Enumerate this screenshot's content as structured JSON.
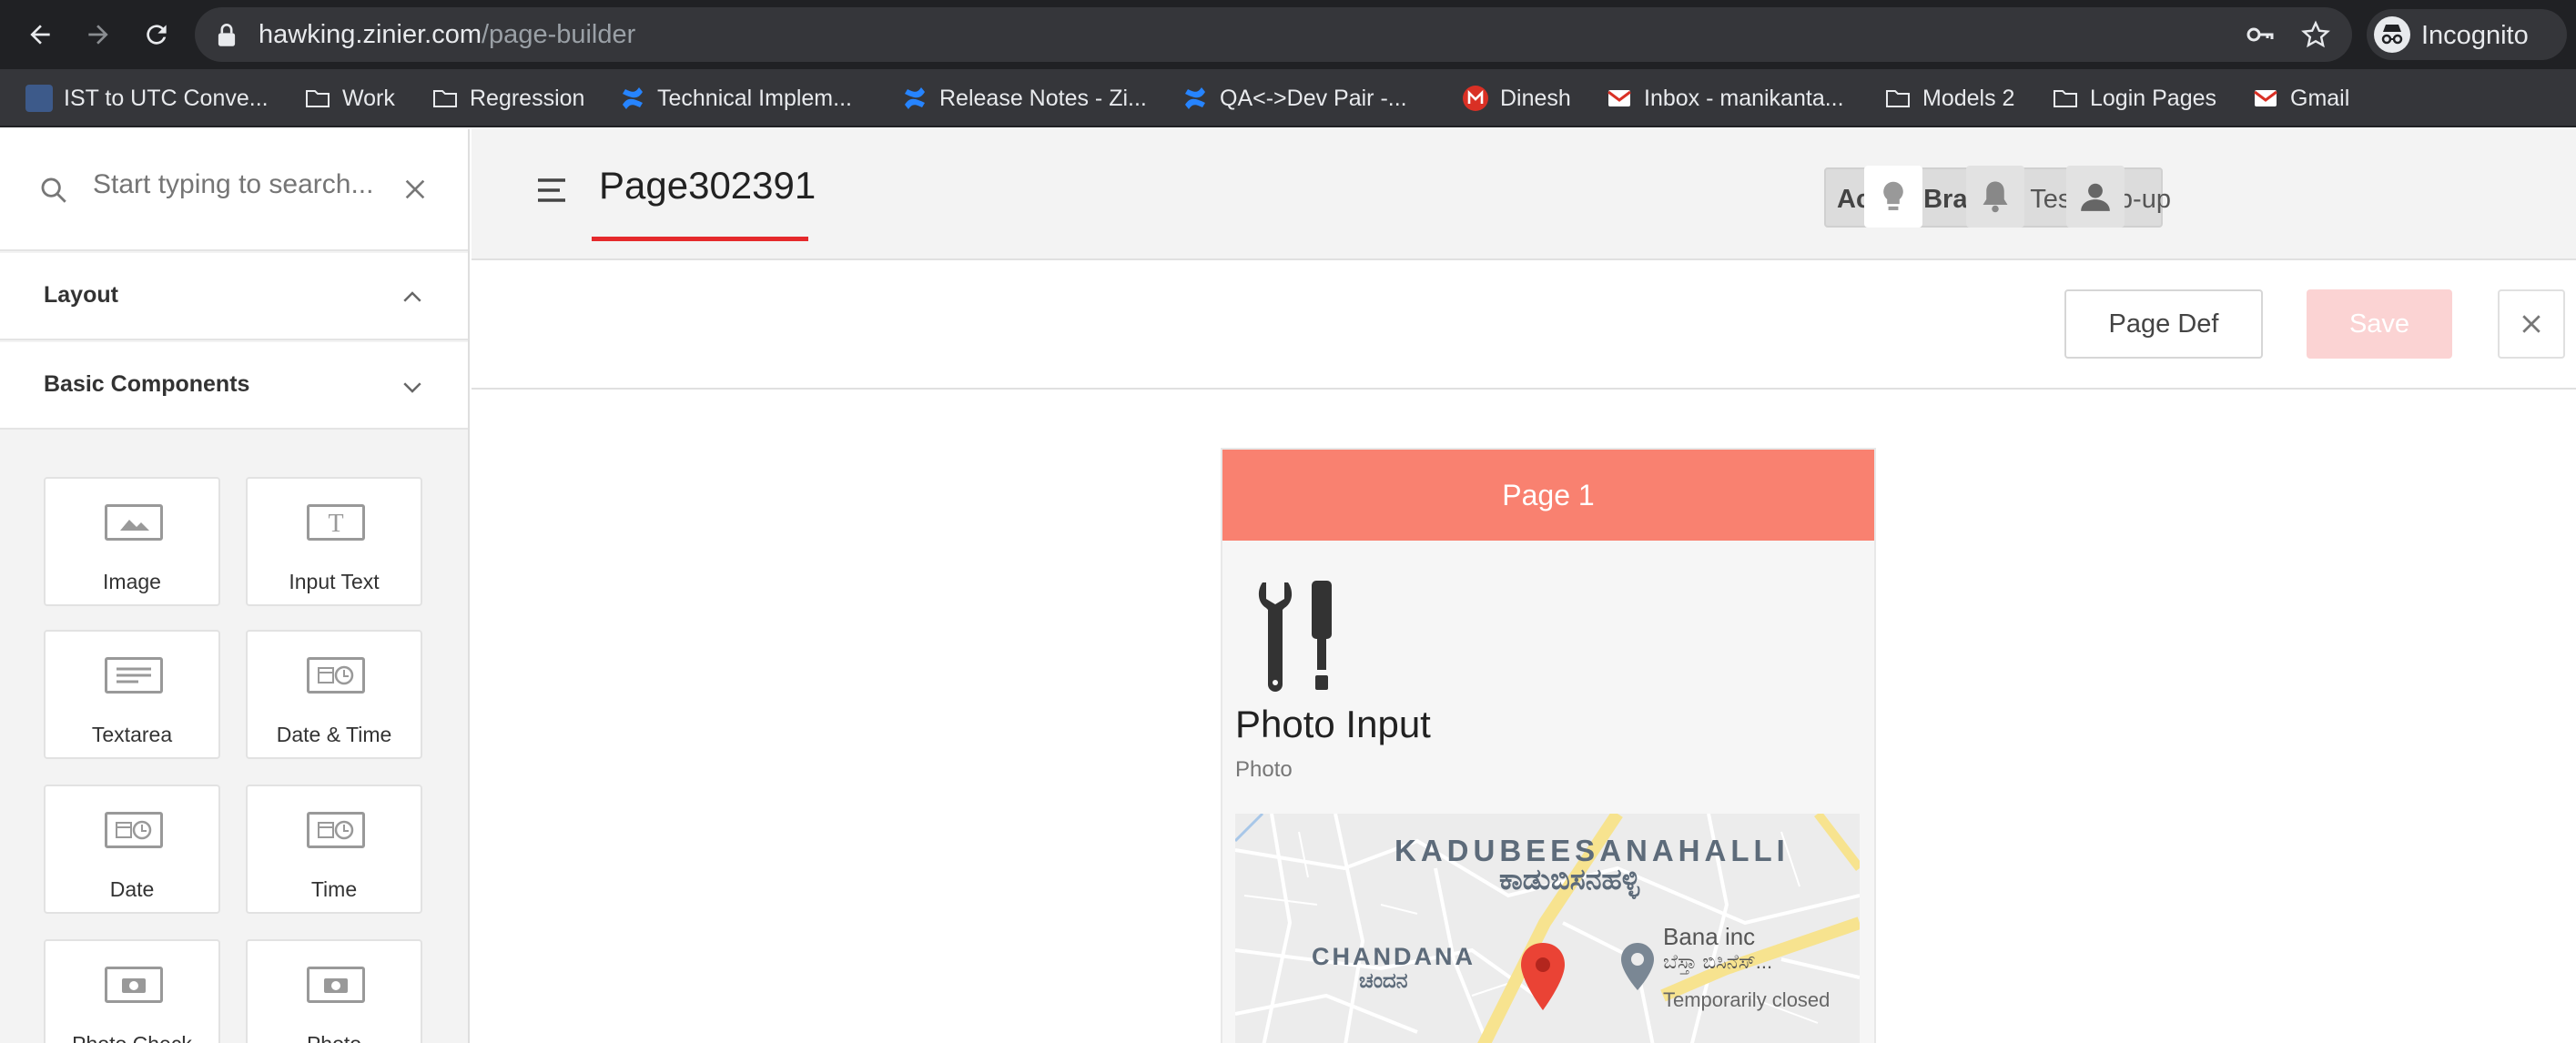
{
  "browser": {
    "url_host": "hawking.zinier.com",
    "url_path": "/page-builder",
    "incognito_label": "Incognito",
    "bookmarks": [
      {
        "label": "IST to UTC Conve...",
        "icon": "clock-favicon"
      },
      {
        "label": "Work",
        "icon": "folder-icon"
      },
      {
        "label": "Regression",
        "icon": "folder-icon"
      },
      {
        "label": "Technical Implem...",
        "icon": "confluence-favicon"
      },
      {
        "label": "Release Notes - Zi...",
        "icon": "confluence-favicon"
      },
      {
        "label": "QA<->Dev Pair -...",
        "icon": "confluence-favicon"
      },
      {
        "label": "Dinesh",
        "icon": "gmail-m-favicon"
      },
      {
        "label": "Inbox - manikanta...",
        "icon": "gmail-favicon"
      },
      {
        "label": "Models 2",
        "icon": "folder-icon"
      },
      {
        "label": "Login Pages",
        "icon": "folder-icon"
      },
      {
        "label": "Gmail",
        "icon": "gmail-favicon"
      }
    ]
  },
  "sidebar": {
    "search_placeholder": "Start typing to search...",
    "sections": [
      {
        "title": "Layout",
        "expanded": true
      },
      {
        "title": "Basic Components",
        "expanded": false
      }
    ],
    "components": [
      {
        "label": "Image",
        "icon": "image-icon"
      },
      {
        "label": "Input Text",
        "icon": "text-icon"
      },
      {
        "label": "Textarea",
        "icon": "textarea-icon"
      },
      {
        "label": "Date & Time",
        "icon": "datetime-icon"
      },
      {
        "label": "Date",
        "icon": "date-icon"
      },
      {
        "label": "Time",
        "icon": "time-icon"
      },
      {
        "label": "Photo Check",
        "icon": "camera-icon"
      },
      {
        "label": "Photo",
        "icon": "camera-icon"
      }
    ]
  },
  "header": {
    "page_title": "Page302391",
    "branch_label": "Active Branch:",
    "branch_value": "Test Pop-up"
  },
  "toolbar": {
    "page_def_label": "Page Def",
    "save_label": "Save"
  },
  "preview": {
    "page_header": "Page 1",
    "component_title": "Photo Input",
    "component_subtitle": "Photo",
    "map": {
      "area1": "KADUBEESANAHALLI",
      "area1_kannada": "ಕಾಡುಬಿಸನಹಳ್ಳಿ",
      "area2": "CHANDANA",
      "area2_kannada": "ಚಂದನ",
      "poi_name": "Bana inc",
      "poi_kannada": "ಬೆಸ್ತಾ ಬಿಸಿನೆಸ್...",
      "poi_status": "Temporarily closed"
    }
  },
  "colors": {
    "accent": "#e5292b",
    "page_header": "#f98170",
    "save_disabled": "#fbd3d3"
  }
}
